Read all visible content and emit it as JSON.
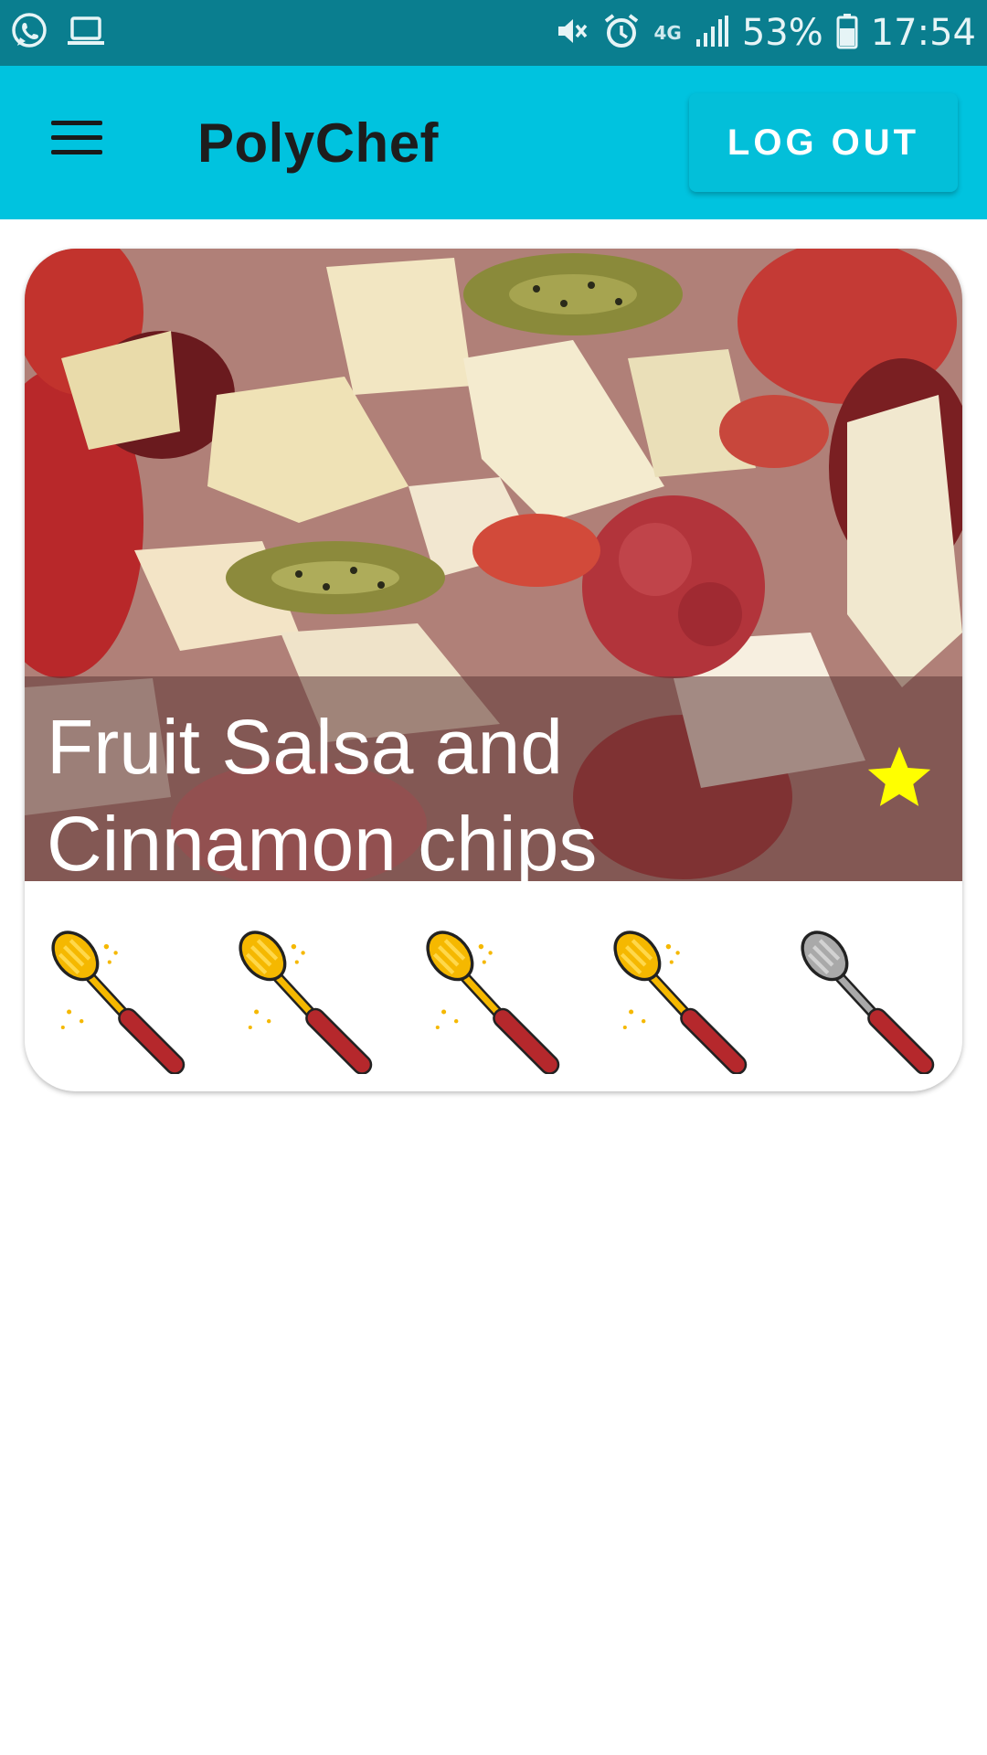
{
  "status_bar": {
    "network": "4G",
    "battery": "53%",
    "time": "17:54",
    "icons": [
      "whatsapp-icon",
      "laptop-icon",
      "mute-icon",
      "alarm-icon",
      "signal-icon",
      "battery-icon"
    ]
  },
  "app_bar": {
    "title": "PolyChef",
    "logout_label": "LOG OUT",
    "background": "#00c3df"
  },
  "recipe_card": {
    "title": "Fruit Salsa and Cinnamon chips",
    "favorite": true,
    "favorite_color": "#ffff00",
    "rating": {
      "value": 4,
      "max": 5,
      "icon": "whisk-icon"
    }
  }
}
